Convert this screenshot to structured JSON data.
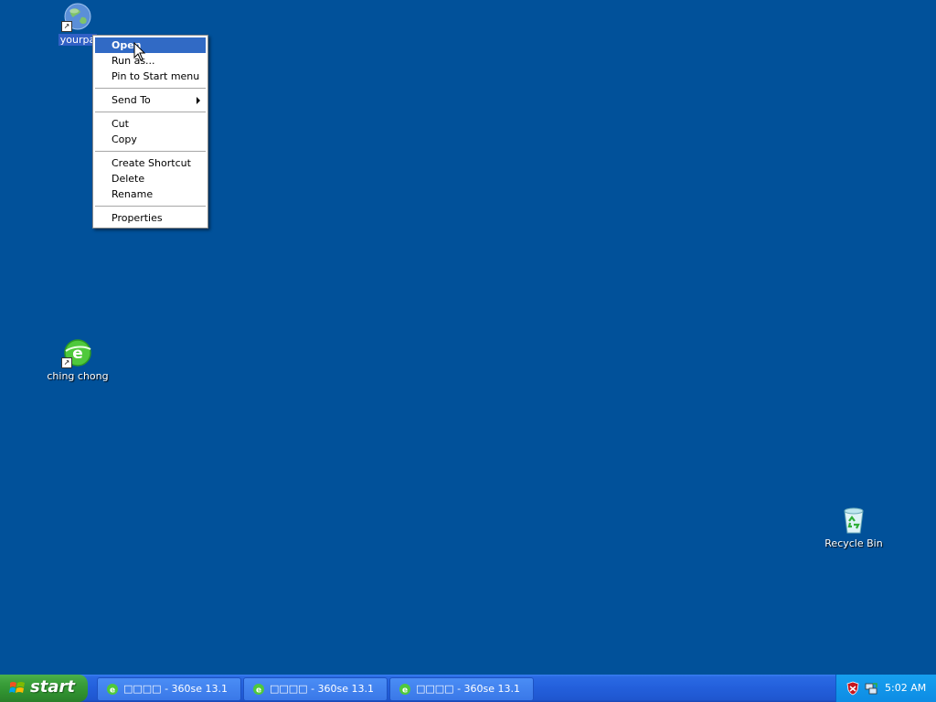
{
  "desktop": {
    "icons": [
      {
        "label": "yourpa",
        "icon": "globe-shortcut-icon"
      },
      {
        "label": "ching chong",
        "icon": "360-browser-icon"
      },
      {
        "label": "Recycle Bin",
        "icon": "recycle-bin-icon"
      }
    ]
  },
  "context_menu": {
    "items": [
      {
        "label": "Open"
      },
      {
        "label": "Run as..."
      },
      {
        "label": "Pin to Start menu"
      },
      {
        "label": "Send To"
      },
      {
        "label": "Cut"
      },
      {
        "label": "Copy"
      },
      {
        "label": "Create Shortcut"
      },
      {
        "label": "Delete"
      },
      {
        "label": "Rename"
      },
      {
        "label": "Properties"
      }
    ]
  },
  "taskbar": {
    "start_label": "start",
    "tasks": [
      {
        "label": "□□□□ - 360se 13.1"
      },
      {
        "label": "□□□□ - 360se 13.1"
      },
      {
        "label": "□□□□ - 360se 13.1"
      }
    ],
    "clock": "5:02 AM"
  },
  "colors": {
    "desktop_bg": "#01519a",
    "menu_highlight": "#316ac5",
    "start_green": "#3b9f3b",
    "taskbar_blue": "#235fdb"
  }
}
